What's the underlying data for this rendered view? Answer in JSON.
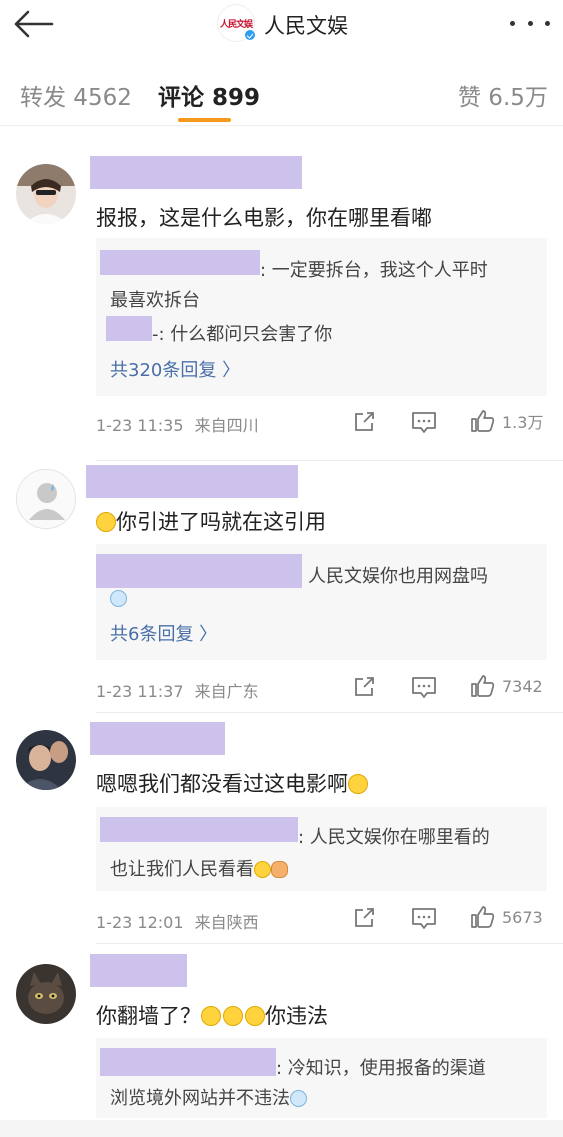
{
  "header": {
    "account_name": "人民文娱",
    "logo_text": "人民文娱"
  },
  "tabs": {
    "repost": "转发 4562",
    "comments": "评论 899",
    "likes": "赞 6.5万"
  },
  "comments": [
    {
      "text": "报报，这是什么电影，你在哪里看嘟",
      "replies": [
        {
          "line1": ": 一定要拆台，我这个人平时",
          "line2": "最喜欢拆台"
        },
        {
          "line1": "-: 什么都问只会害了你"
        }
      ],
      "more_replies": "共320条回复 〉",
      "time": "1-23 11:35",
      "location": "来自四川",
      "likes": "1.3万"
    },
    {
      "text": "你引进了吗就在这引用",
      "replies": [
        {
          "line1": "人民文娱你也用网盘吗"
        }
      ],
      "more_replies": "共6条回复 〉",
      "time": "1-23 11:37",
      "location": "来自广东",
      "likes": "7342"
    },
    {
      "text": "嗯嗯我们都没看过这电影啊",
      "replies": [
        {
          "line1": ": 人民文娱你在哪里看的",
          "line2": "也让我们人民看看"
        }
      ],
      "time": "1-23 12:01",
      "location": "来自陕西",
      "likes": "5673"
    },
    {
      "text_a": "你翻墙了？",
      "text_b": "你违法",
      "replies": [
        {
          "line1": ": 冷知识，使用报备的渠道",
          "line2": "浏览境外网站并不违法"
        }
      ]
    }
  ],
  "colors": {
    "accent": "#f79a1b",
    "link": "#4a6fa8",
    "redaction": "#cdc2ec"
  }
}
